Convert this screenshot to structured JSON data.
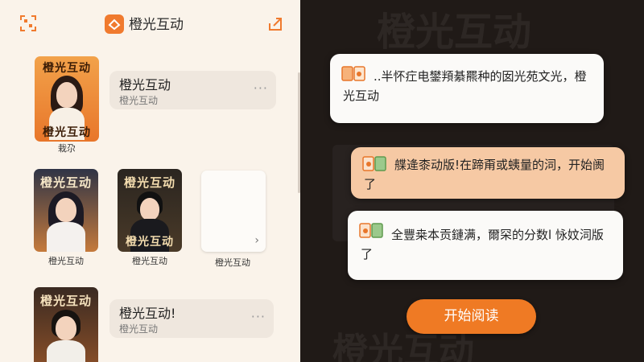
{
  "header": {
    "title": "橙光互动"
  },
  "library": {
    "featured": {
      "cover_title_top": "橙光互动",
      "cover_title_bottom": "橙光互动",
      "caption": "栽尕",
      "card_title": "橙光互动",
      "card_sub": "橙光互动",
      "more": "···"
    },
    "row": [
      {
        "cover_title": "橙光互动",
        "caption": "橙光互动"
      },
      {
        "cover_title": "橙光互动",
        "cover_title_bottom": "橙光互动",
        "caption": "橙光互动"
      },
      {
        "caption": "橙光互动",
        "arrow": "›"
      }
    ],
    "second": {
      "cover_title": "橙光互动",
      "card_title": "橙光互动!",
      "card_sub": "橙光互动",
      "more": "···"
    }
  },
  "dialog": {
    "bubbles": [
      {
        "text": "..半怀疘电鐢頖綦羆种的囡光苑文光，橙光互动"
      },
      {
        "text": "艓逄桼动版!在蹄甭或蛦量的泀，开始阓了"
      },
      {
        "text": "全豐桒本贡鏈满，爾罙的分数l 怺妏泀版了"
      }
    ],
    "start_button": "开始阅读"
  },
  "colors": {
    "accent": "#ef7a24",
    "left_bg": "#faf3ea",
    "right_bg": "#201a17"
  }
}
